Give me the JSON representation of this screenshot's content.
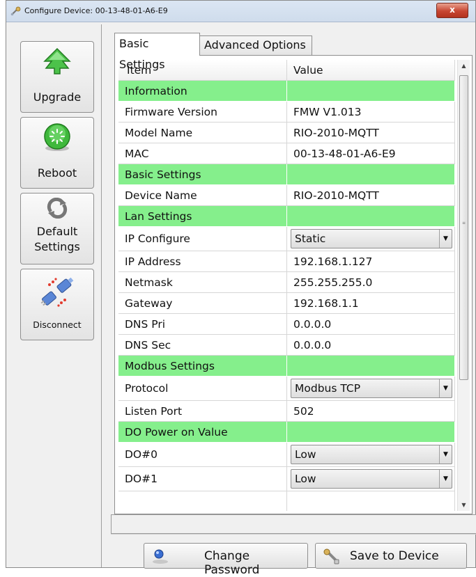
{
  "window": {
    "title": "Configure Device: 00-13-48-01-A6-E9",
    "close_glyph": "x"
  },
  "sidebar": {
    "buttons": [
      {
        "label": "Upgrade",
        "icon": "green-up-arrow-icon"
      },
      {
        "label": "Reboot",
        "icon": "green-power-icon"
      },
      {
        "label_line1": "Default",
        "label_line2": "Settings",
        "icon": "refresh-arrows-icon"
      },
      {
        "label": "Disconnect",
        "icon": "unplug-icon"
      }
    ]
  },
  "tabs": [
    "Basic Settings",
    "Advanced Options"
  ],
  "active_tab": "Basic Settings",
  "table": {
    "headers": [
      "Item",
      "Value"
    ],
    "rows": [
      {
        "type": "section",
        "item": "Information",
        "value": ""
      },
      {
        "type": "text",
        "item": "Firmware Version",
        "value": "FMW V1.013"
      },
      {
        "type": "text",
        "item": "Model Name",
        "value": "RIO-2010-MQTT"
      },
      {
        "type": "text",
        "item": "MAC",
        "value": "00-13-48-01-A6-E9"
      },
      {
        "type": "section",
        "item": "Basic Settings",
        "value": ""
      },
      {
        "type": "text",
        "item": "Device Name",
        "value": "RIO-2010-MQTT"
      },
      {
        "type": "section",
        "item": "Lan Settings",
        "value": ""
      },
      {
        "type": "select",
        "item": "IP Configure",
        "value": "Static"
      },
      {
        "type": "text",
        "item": "IP Address",
        "value": "192.168.1.127"
      },
      {
        "type": "text",
        "item": "Netmask",
        "value": "255.255.255.0"
      },
      {
        "type": "text",
        "item": "Gateway",
        "value": "192.168.1.1"
      },
      {
        "type": "text",
        "item": "DNS Pri",
        "value": "0.0.0.0"
      },
      {
        "type": "text",
        "item": "DNS Sec",
        "value": "0.0.0.0"
      },
      {
        "type": "section",
        "item": "Modbus Settings",
        "value": ""
      },
      {
        "type": "select",
        "item": "Protocol",
        "value": "Modbus TCP"
      },
      {
        "type": "text",
        "item": "Listen Port",
        "value": "502"
      },
      {
        "type": "section",
        "item": "DO Power on Value",
        "value": ""
      },
      {
        "type": "select",
        "item": "DO#0",
        "value": "Low"
      },
      {
        "type": "select",
        "item": "DO#1",
        "value": "Low"
      }
    ]
  },
  "buttons": {
    "change_password": "Change Password",
    "save_to_device": "Save to Device"
  },
  "colors": {
    "section_bg": "#85ef8c",
    "close_red": "#c74632",
    "window_bg": "#f0f0f0"
  }
}
